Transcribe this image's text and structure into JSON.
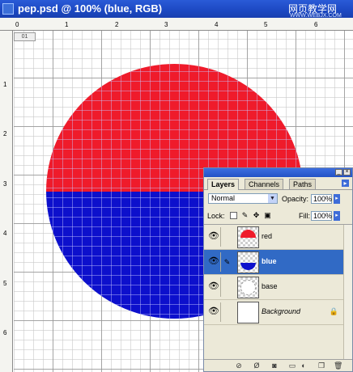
{
  "window": {
    "title": "pep.psd @ 100% (blue, RGB)",
    "watermark": "网页教学网",
    "watermark_url": "WWW.WEBJX.COM"
  },
  "rulers": {
    "top_numbers": [
      "0",
      "1",
      "2",
      "3",
      "4",
      "5",
      "6"
    ],
    "left_numbers": [
      "1",
      "2",
      "3",
      "4",
      "5",
      "6"
    ],
    "zoom_badge": "01"
  },
  "artwork": {
    "top_color": "#ef1b2b",
    "bottom_color": "#0d10cc"
  },
  "layers_panel": {
    "tabs": [
      {
        "label": "Layers",
        "active": true
      },
      {
        "label": "Channels",
        "active": false
      },
      {
        "label": "Paths",
        "active": false
      }
    ],
    "blend_mode": "Normal",
    "opacity_label": "Opacity:",
    "opacity_value": "100%",
    "lock_label": "Lock:",
    "fill_label": "Fill:",
    "fill_value": "100%",
    "layers": [
      {
        "name": "red",
        "visible": true,
        "selected": false,
        "thumb": "red-half"
      },
      {
        "name": "blue",
        "visible": true,
        "selected": true,
        "thumb": "blue-half"
      },
      {
        "name": "base",
        "visible": true,
        "selected": false,
        "thumb": "dotted-circle"
      },
      {
        "name": "Background",
        "visible": true,
        "selected": false,
        "thumb": "white",
        "locked": true
      }
    ],
    "footer_icons": [
      "link-icon",
      "layer-style-icon",
      "mask-icon",
      "new-set-icon",
      "adjustment-icon",
      "new-layer-icon",
      "trash-icon"
    ]
  }
}
